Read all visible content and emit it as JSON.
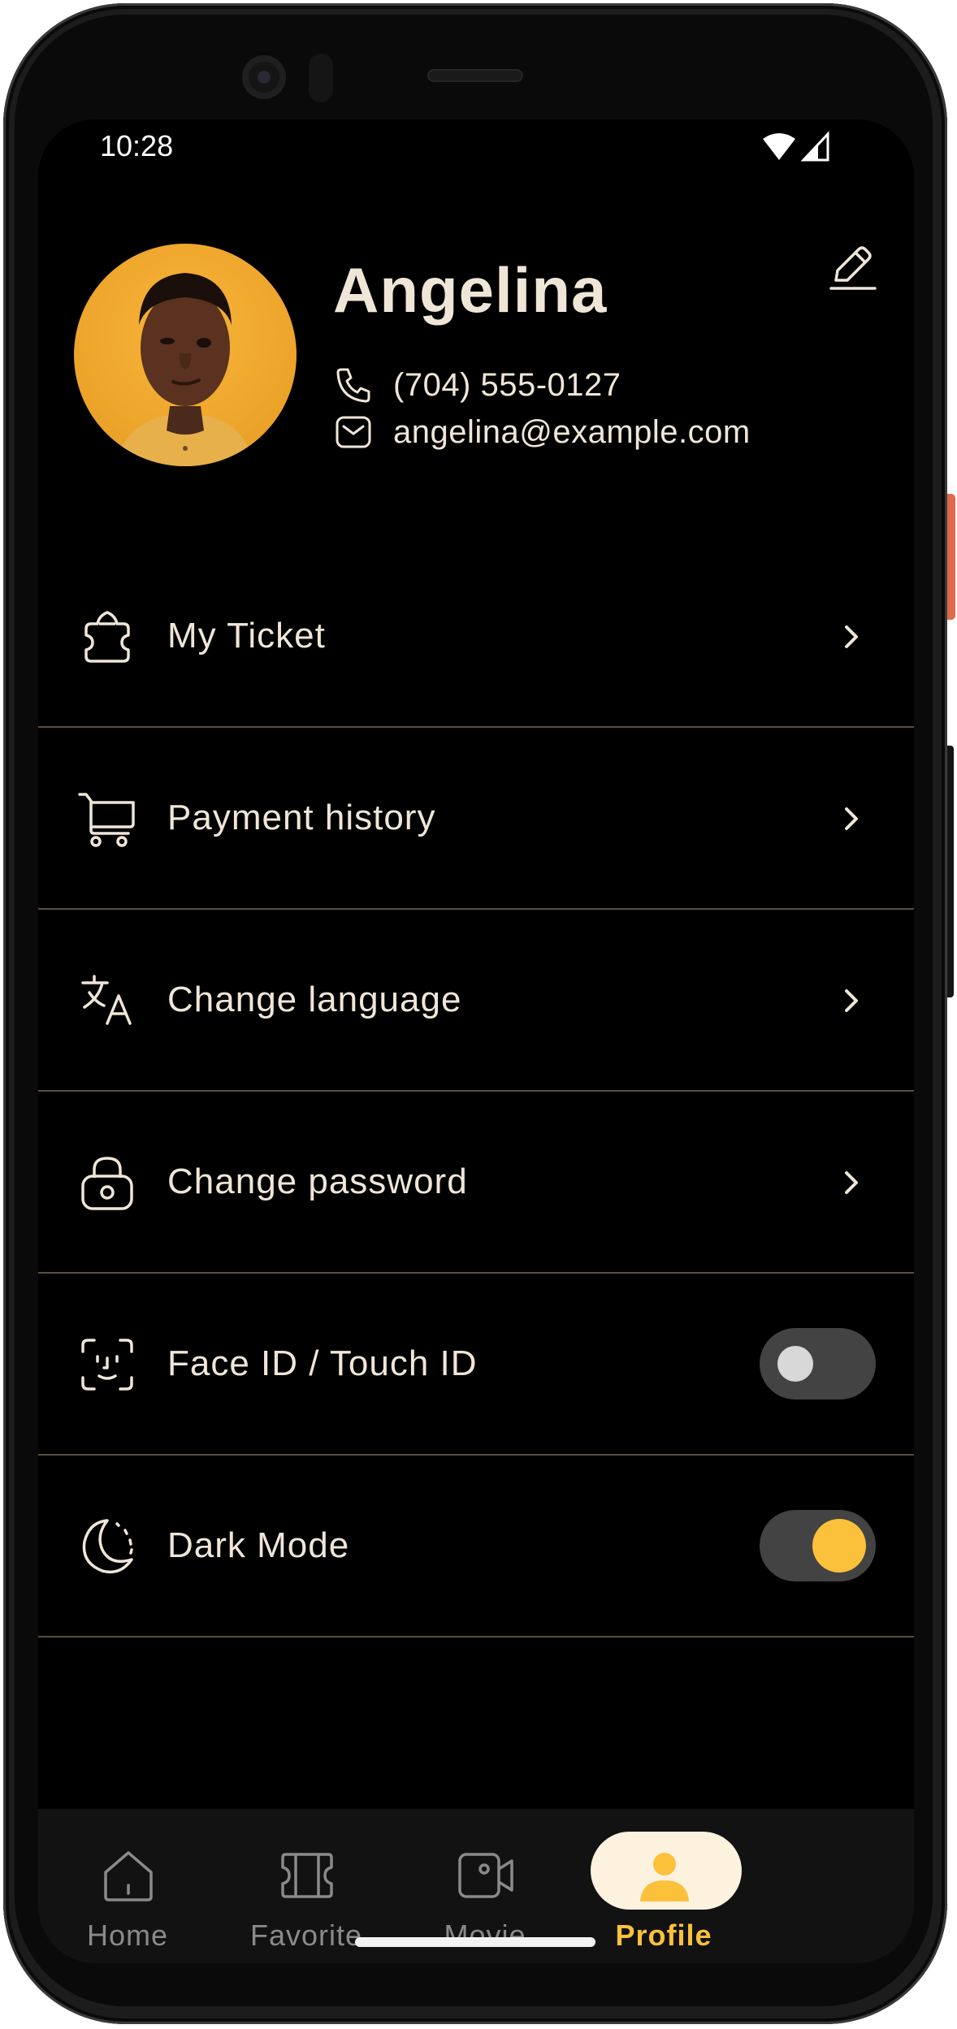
{
  "status_bar": {
    "time": "10:28"
  },
  "profile": {
    "name": "Angelina",
    "phone": "(704) 555-0127",
    "email": "angelina@example.com"
  },
  "menu": {
    "items": [
      {
        "label": "My Ticket",
        "icon": "ticket-icon",
        "control": "chevron"
      },
      {
        "label": "Payment history",
        "icon": "cart-icon",
        "control": "chevron"
      },
      {
        "label": "Change language",
        "icon": "translate-icon",
        "control": "chevron"
      },
      {
        "label": "Change password",
        "icon": "lock-icon",
        "control": "chevron"
      },
      {
        "label": "Face ID / Touch ID",
        "icon": "face-id-icon",
        "control": "toggle",
        "enabled": false
      },
      {
        "label": "Dark Mode",
        "icon": "moon-icon",
        "control": "toggle",
        "enabled": true
      }
    ]
  },
  "bottom_nav": {
    "items": [
      {
        "label": "Home",
        "icon": "home-icon",
        "active": false
      },
      {
        "label": "Favorite",
        "icon": "ticket-icon",
        "active": false
      },
      {
        "label": "Movie",
        "icon": "video-camera-icon",
        "active": false
      },
      {
        "label": "Profile",
        "icon": "user-icon",
        "active": true
      }
    ]
  },
  "colors": {
    "background": "#000000",
    "text": "#efe6d8",
    "accent": "#fbc13b",
    "divider": "#5a4e3f",
    "nav_background": "#121212",
    "active_pill": "#fcf2de",
    "inactive_nav": "#8a8a8a"
  }
}
